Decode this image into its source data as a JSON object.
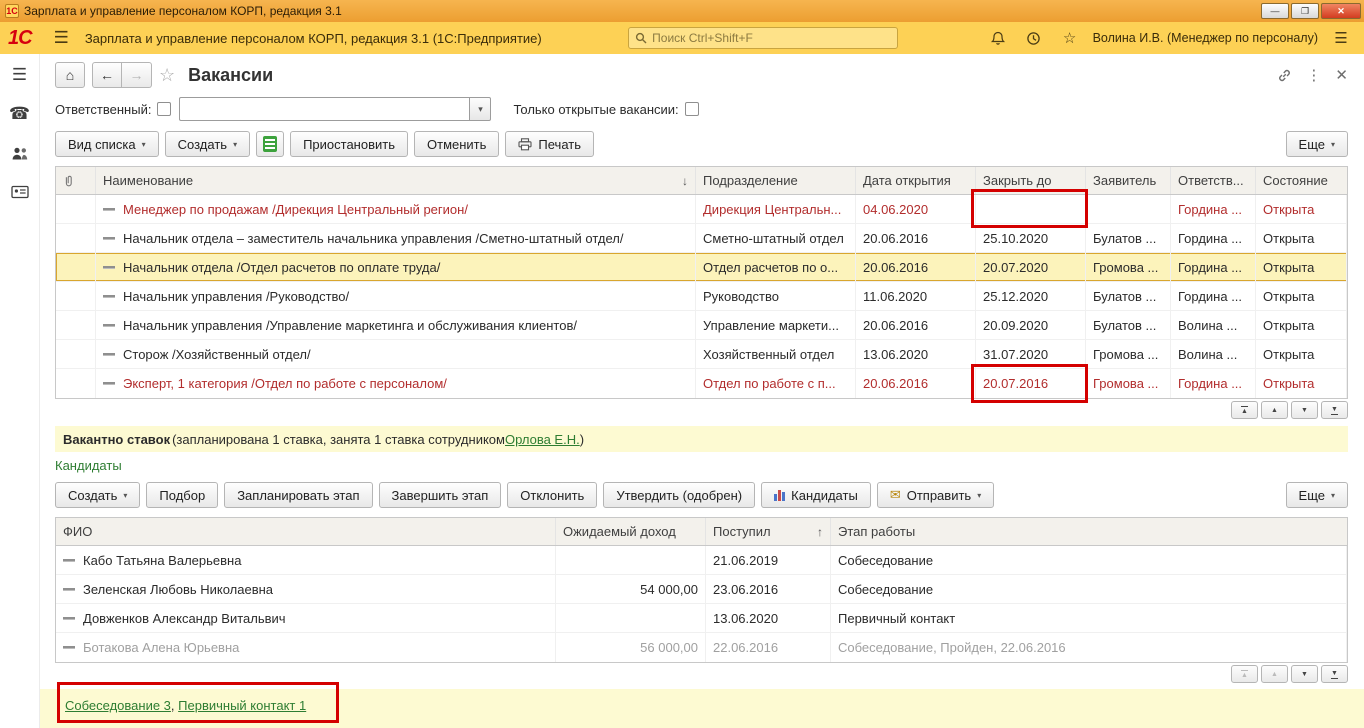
{
  "window": {
    "title": "Зарплата и управление персоналом КОРП, редакция 3.1",
    "controls": {
      "minimize": "—",
      "restore": "❐",
      "close": "✕"
    }
  },
  "appbar": {
    "logo": "1С",
    "title": "Зарплата и управление персоналом КОРП, редакция 3.1  (1С:Предприятие)",
    "search_placeholder": "Поиск Ctrl+Shift+F",
    "user": "Волина И.В. (Менеджер по персоналу)"
  },
  "icons": {
    "menu": "☰",
    "phone": "☎",
    "star": "☆",
    "dots": "⋮",
    "close": "✕",
    "home": "⌂",
    "back": "←",
    "forward": "→",
    "caret_down": "▾",
    "sort_down": "↓",
    "sort_up": "↑",
    "envelope": "✉"
  },
  "page": {
    "title": "Вакансии",
    "filters": {
      "responsible_label": "Ответственный:",
      "only_open_label": "Только открытые вакансии:"
    },
    "toolbar": {
      "view_list": "Вид списка",
      "create": "Создать",
      "suspend": "Приостановить",
      "cancel": "Отменить",
      "print": "Печать",
      "more": "Еще"
    },
    "vacancies": {
      "columns": {
        "name": "Наименование",
        "dept": "Подразделение",
        "opened": "Дата открытия",
        "close": "Закрыть до",
        "applicant": "Заявитель",
        "responsible": "Ответств...",
        "state": "Состояние"
      },
      "rows": [
        {
          "name": "Менеджер по продажам /Дирекция Центральный регион/",
          "dept": "Дирекция Центральн...",
          "opened": "04.06.2020",
          "close": "",
          "applicant": "",
          "responsible": "Гордина ...",
          "state": "Открыта"
        },
        {
          "name": "Начальник отдела – заместитель начальника управления /Сметно-штатный отдел/",
          "dept": "Сметно-штатный отдел",
          "opened": "20.06.2016",
          "close": "25.10.2020",
          "applicant": "Булатов ...",
          "responsible": "Гордина ...",
          "state": "Открыта"
        },
        {
          "name": "Начальник отдела /Отдел расчетов по оплате труда/",
          "dept": "Отдел расчетов по о...",
          "opened": "20.06.2016",
          "close": "20.07.2020",
          "applicant": "Громова ...",
          "responsible": "Гордина ...",
          "state": "Открыта"
        },
        {
          "name": "Начальник управления /Руководство/",
          "dept": "Руководство",
          "opened": "11.06.2020",
          "close": "25.12.2020",
          "applicant": "Булатов ...",
          "responsible": "Гордина ...",
          "state": "Открыта"
        },
        {
          "name": "Начальник управления /Управление маркетинга и обслуживания клиентов/",
          "dept": "Управление маркети...",
          "opened": "20.06.2016",
          "close": "20.09.2020",
          "applicant": "Булатов ...",
          "responsible": "Волина ...",
          "state": "Открыта"
        },
        {
          "name": "Сторож /Хозяйственный отдел/",
          "dept": "Хозяйственный отдел",
          "opened": "13.06.2020",
          "close": "31.07.2020",
          "applicant": "Громова ...",
          "responsible": "Волина ...",
          "state": "Открыта"
        },
        {
          "name": "Эксперт, 1 категория /Отдел по работе с персоналом/",
          "dept": "Отдел по работе с п...",
          "opened": "20.06.2016",
          "close": "20.07.2016",
          "applicant": "Громова ...",
          "responsible": "Гордина ...",
          "state": "Открыта"
        }
      ]
    },
    "info_bar": {
      "bold": "Вакантно  ставок",
      "mid": "(запланирована 1 ставка, занята 1 ставка сотрудником ",
      "link": "Орлова Е.Н.",
      "end": ")"
    },
    "candidates": {
      "label": "Кандидаты",
      "toolbar": {
        "create": "Создать",
        "selection": "Подбор",
        "plan_stage": "Запланировать этап",
        "finish_stage": "Завершить этап",
        "reject": "Отклонить",
        "approve": "Утвердить (одобрен)",
        "candidates": "Кандидаты",
        "send": "Отправить",
        "more": "Еще"
      },
      "columns": {
        "fio": "ФИО",
        "income": "Ожидаемый доход",
        "received": "Поступил",
        "stage": "Этап работы"
      },
      "rows": [
        {
          "fio": "Кабо Татьяна Валерьевна",
          "income": "",
          "received": "21.06.2019",
          "stage": "Собеседование"
        },
        {
          "fio": "Зеленская Любовь Николаевна",
          "income": "54 000,00",
          "received": "23.06.2016",
          "stage": "Собеседование"
        },
        {
          "fio": "Довженков Александр Витальвич",
          "income": "",
          "received": "13.06.2020",
          "stage": "Первичный контакт"
        },
        {
          "fio": "Ботакова Алена Юрьевна",
          "income": "56 000,00",
          "received": "22.06.2016",
          "stage": "Собеседование, Пройден, 22.06.2016"
        }
      ]
    },
    "footer": {
      "link1": "Собеседование 3",
      "sep": ", ",
      "link2": "Первичный контакт 1"
    }
  },
  "colors": {
    "titlebar": "#f2a93d",
    "appbar": "#fdd155",
    "overdue_red": "#b22d2d",
    "link_green": "#2e7d32",
    "selection_yellow": "#fcf3bb",
    "annotation_red": "#d40000"
  }
}
